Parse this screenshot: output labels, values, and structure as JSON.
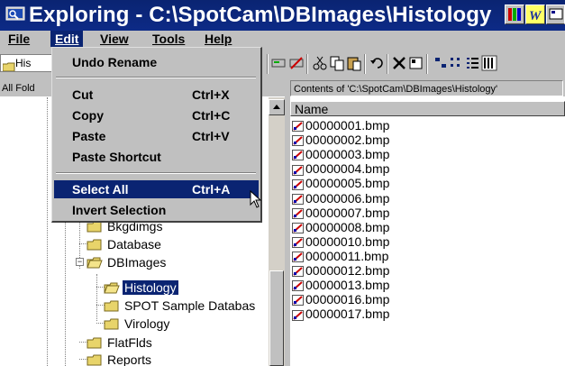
{
  "window": {
    "title": "Exploring - C:\\SpotCam\\DBImages\\Histology",
    "icon": "explorer-icon"
  },
  "menubar": {
    "items": [
      {
        "label": "File",
        "active": false
      },
      {
        "label": "Edit",
        "active": true
      },
      {
        "label": "View",
        "active": false
      },
      {
        "label": "Tools",
        "active": false
      },
      {
        "label": "Help",
        "active": false
      }
    ]
  },
  "toolbar": {
    "address_value": "His"
  },
  "panes": {
    "left_header": "All Fold",
    "right_header": "Contents of 'C:\\SpotCam\\DBImages\\Histology'"
  },
  "edit_menu": {
    "undo": "Undo Rename",
    "cut": {
      "label": "Cut",
      "shortcut": "Ctrl+X"
    },
    "copy": {
      "label": "Copy",
      "shortcut": "Ctrl+C"
    },
    "paste": {
      "label": "Paste",
      "shortcut": "Ctrl+V"
    },
    "paste_shortcut": "Paste Shortcut",
    "select_all": {
      "label": "Select All",
      "shortcut": "Ctrl+A"
    },
    "invert": "Invert Selection"
  },
  "tree": {
    "items": [
      {
        "label": "Bkgdimgs"
      },
      {
        "label": "Database"
      },
      {
        "label": "DBImages"
      },
      {
        "label": "Histology",
        "selected": true
      },
      {
        "label": "SPOT Sample Databas"
      },
      {
        "label": "Virology"
      },
      {
        "label": "FlatFlds"
      },
      {
        "label": "Reports"
      }
    ]
  },
  "list": {
    "column_name": "Name",
    "files": [
      "00000001.bmp",
      "00000002.bmp",
      "00000003.bmp",
      "00000004.bmp",
      "00000005.bmp",
      "00000006.bmp",
      "00000007.bmp",
      "00000008.bmp",
      "00000010.bmp",
      "00000011.bmp",
      "00000012.bmp",
      "00000013.bmp",
      "00000016.bmp",
      "00000017.bmp"
    ]
  },
  "colors": {
    "titlebar": "#0a2472",
    "highlight": "#0a2472",
    "face": "#c0c0c0"
  }
}
